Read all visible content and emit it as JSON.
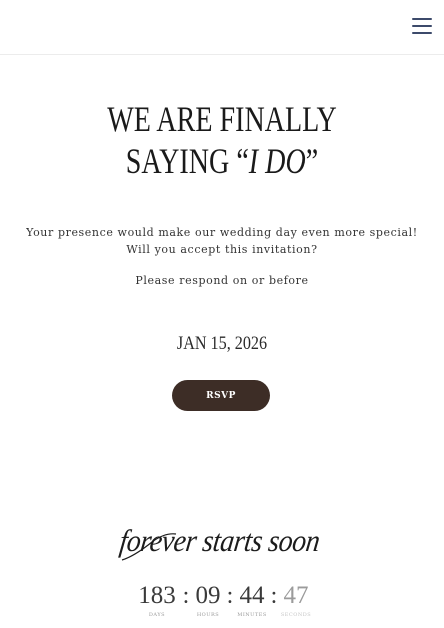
{
  "header": {
    "menu_icon": "hamburger-menu-icon"
  },
  "hero": {
    "headline_line1": "WE ARE FINALLY",
    "headline_line2_prefix": "SAYING “",
    "headline_line2_em": "I DO",
    "headline_line2_suffix": "”",
    "message_line1": "Your presence would make our wedding day even more special!",
    "message_line2": "Will you accept this invitation?",
    "respond_text": "Please respond on or before",
    "date": "JAN 15, 2026",
    "rsvp_label": "RSVP"
  },
  "countdown": {
    "script_title": "forever starts soon",
    "days": "183",
    "hours": "09",
    "minutes": "44",
    "seconds": "47",
    "days_label": "DAYS",
    "hours_label": "HOURS",
    "minutes_label": "MINUTES",
    "seconds_label": "SECONDS",
    "separator": ":"
  },
  "colors": {
    "button_bg": "#3d2d26",
    "menu_icon": "#3c4a6b",
    "text": "#2b2b2b"
  }
}
